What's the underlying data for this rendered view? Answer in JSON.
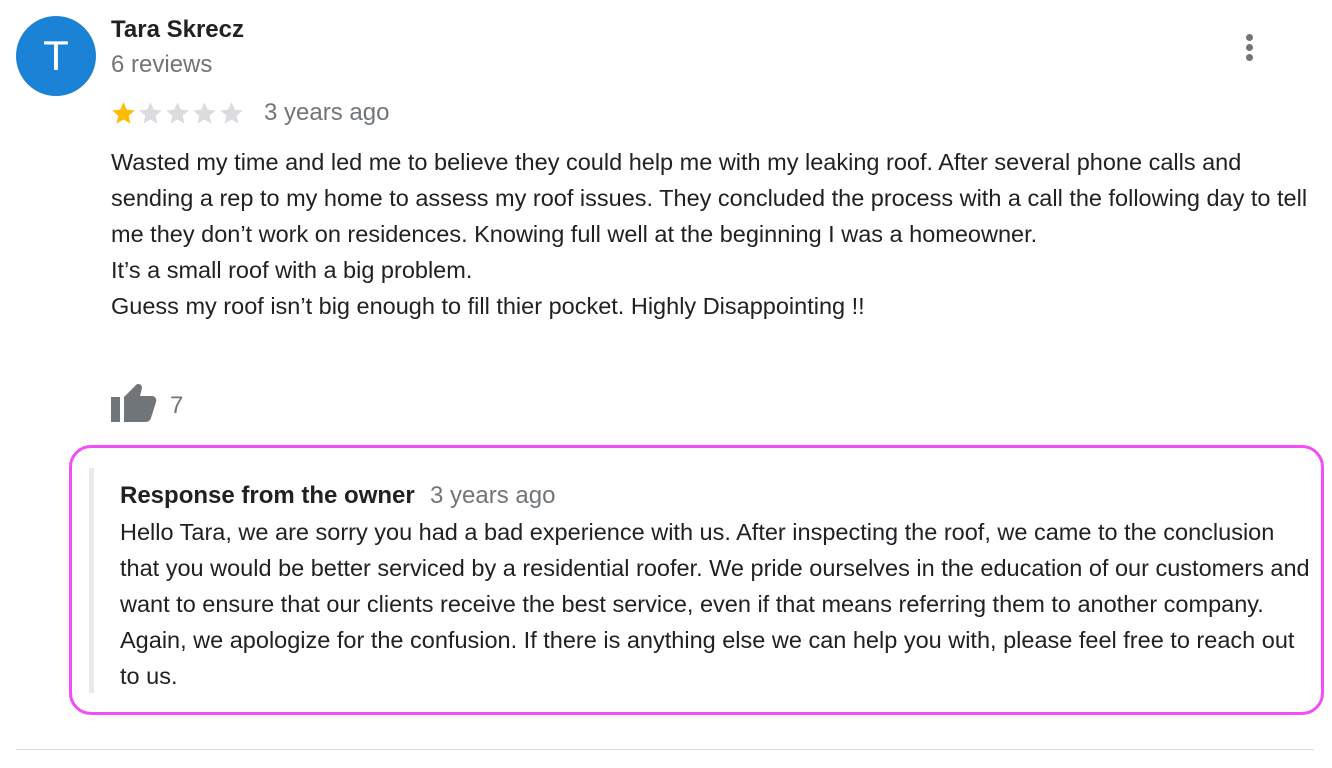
{
  "review": {
    "avatar_letter": "T",
    "avatar_color": "#1b82d6",
    "author_name": "Tara Skrecz",
    "review_count": "6 reviews",
    "rating": 1,
    "rating_max": 5,
    "star_filled_color": "#fbbc04",
    "star_empty_color": "#dadce0",
    "time": "3 years ago",
    "text_lines": [
      "Wasted my time and led me to believe they could help me with my leaking roof. After several phone calls and sending a rep to my home to assess my roof issues. They concluded the process with a call the following day to tell me they don’t work on residences. Knowing full well at the beginning I was a homeowner.",
      "It’s a small roof with a big problem.",
      "Guess my roof isn’t big enough to fill thier pocket. Highly Disappointing !!"
    ],
    "like_icon": "thumbs-up-icon",
    "like_count": "7",
    "more_icon": "more-vertical-icon"
  },
  "owner_response": {
    "heading": "Response from the owner",
    "time": "3 years ago",
    "text": "Hello Tara, we are sorry you had a bad experience with us. After inspecting the roof, we came to the conclusion that you would be better serviced by a residential roofer. We pride ourselves in the education of our customers and want to ensure that our clients receive the best service, even if that means referring them to another company. Again, we apologize for the confusion. If there is anything else we can help you with, please feel free to reach out to us.",
    "highlight_color": "#f14ff5"
  }
}
